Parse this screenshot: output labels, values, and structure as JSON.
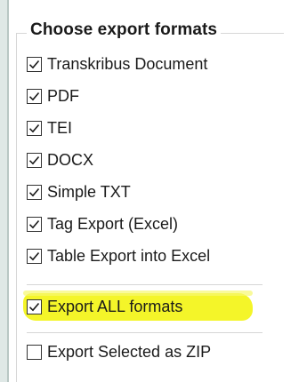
{
  "group": {
    "title": "Choose export formats"
  },
  "formats": [
    {
      "label": "Transkribus Document",
      "checked": true
    },
    {
      "label": "PDF",
      "checked": true
    },
    {
      "label": "TEI",
      "checked": true
    },
    {
      "label": "DOCX",
      "checked": true
    },
    {
      "label": "Simple TXT",
      "checked": true
    },
    {
      "label": "Tag Export (Excel)",
      "checked": true
    },
    {
      "label": "Table Export into Excel",
      "checked": true
    }
  ],
  "export_all": {
    "label": "Export ALL formats",
    "checked": true
  },
  "export_zip": {
    "label": "Export Selected as ZIP",
    "checked": false
  },
  "colors": {
    "highlight": "#f4f51e",
    "check": "#1a1a1a"
  }
}
